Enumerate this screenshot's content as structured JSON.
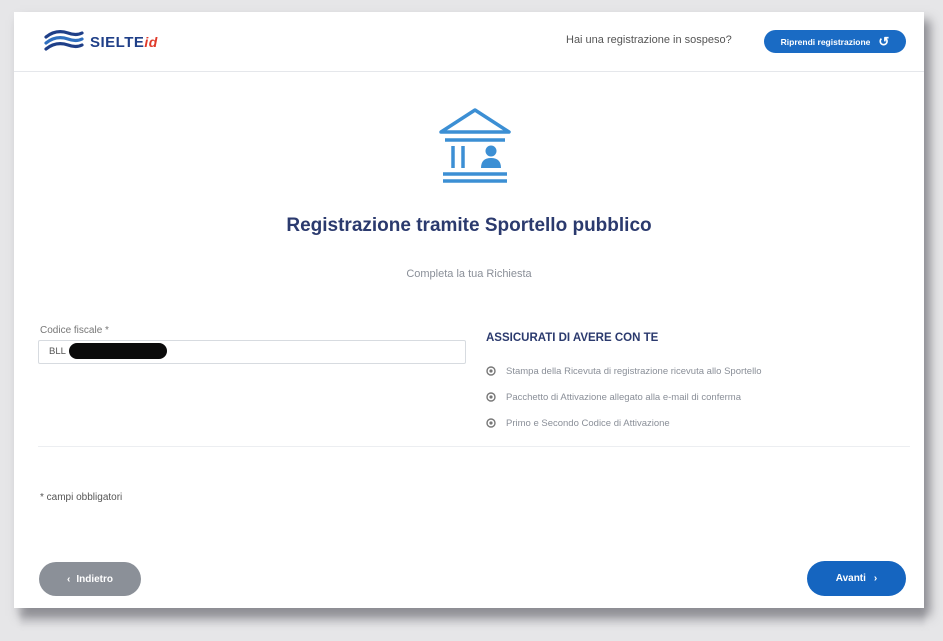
{
  "header": {
    "logo_text": "SIELTE",
    "logo_suffix": "id",
    "pending_question": "Hai una registrazione in sospeso?",
    "resume_label": "Riprendi registrazione",
    "resume_icon": "undo-icon"
  },
  "hero": {
    "icon": "public-building-icon",
    "title": "Registrazione tramite Sportello pubblico",
    "subtitle": "Completa la tua Richiesta"
  },
  "form": {
    "fiscal_code_label": "Codice fiscale *",
    "fiscal_code_value": "BLL"
  },
  "checklist": {
    "title": "ASSICURATI DI AVERE CON TE",
    "items": [
      "Stampa della Ricevuta di registrazione ricevuta allo Sportello",
      "Pacchetto di Attivazione allegato alla e-mail di conferma",
      "Primo e Secondo Codice di Attivazione"
    ]
  },
  "footer": {
    "required_note": "* campi obbligatori",
    "back_label": "Indietro",
    "next_label": "Avanti"
  },
  "colors": {
    "primary": "#1565c0",
    "title": "#2b3a6e",
    "icon": "#3c8fd4",
    "back_button": "#8b9098"
  }
}
